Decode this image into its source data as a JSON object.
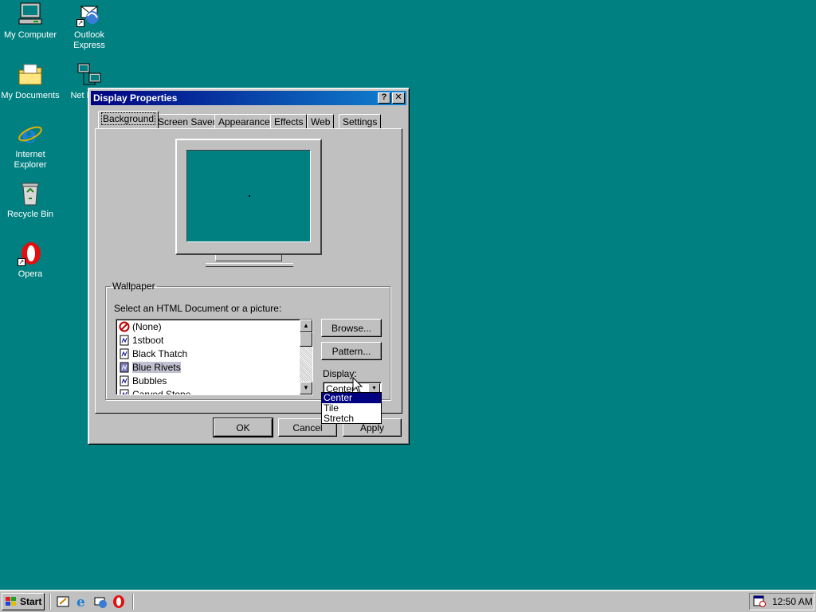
{
  "desktop": {
    "icons": [
      {
        "label": "My Computer",
        "icon": "my-computer-icon"
      },
      {
        "label": "Outlook Express",
        "icon": "outlook-express-icon"
      },
      {
        "label": "My Documents",
        "icon": "my-documents-icon"
      },
      {
        "label": "Net Neighb",
        "icon": "network-neighborhood-icon"
      },
      {
        "label": "Internet Explorer",
        "icon": "internet-explorer-icon"
      },
      {
        "label": "Recycle Bin",
        "icon": "recycle-bin-icon"
      },
      {
        "label": "Opera",
        "icon": "opera-icon"
      }
    ]
  },
  "window": {
    "title": "Display Properties",
    "help_glyph": "?",
    "close_glyph": "✕",
    "tabs": [
      {
        "label": "Background",
        "active": true
      },
      {
        "label": "Screen Saver"
      },
      {
        "label": "Appearance"
      },
      {
        "label": "Effects"
      },
      {
        "label": "Web"
      },
      {
        "label": "Settings"
      }
    ],
    "wallpaper": {
      "group_label": "Wallpaper",
      "select_label": "Select an HTML Document or a picture:",
      "items": [
        {
          "label": "(None)",
          "icon": "none-icon"
        },
        {
          "label": "1stboot",
          "icon": "bitmap-file-icon"
        },
        {
          "label": "Black Thatch",
          "icon": "bitmap-file-icon"
        },
        {
          "label": "Blue Rivets",
          "icon": "bitmap-file-icon",
          "selected": true
        },
        {
          "label": "Bubbles",
          "icon": "bitmap-file-icon"
        },
        {
          "label": "Carved Stone",
          "icon": "bitmap-file-icon"
        }
      ],
      "browse_label": "Browse...",
      "pattern_label": "Pattern...",
      "display_label": "Display:",
      "display_value": "Center",
      "display_options": [
        "Center",
        "Tile",
        "Stretch"
      ]
    },
    "buttons": {
      "ok": "OK",
      "cancel": "Cancel",
      "apply": "Apply"
    }
  },
  "taskbar": {
    "start_label": "Start",
    "quick_launch": [
      "show-desktop-icon",
      "internet-explorer-icon",
      "outlook-express-icon",
      "opera-icon"
    ],
    "clock": "12:50 AM"
  },
  "colors": {
    "desktop": "#008080",
    "title_active": "#000080",
    "face": "#c0c0c0",
    "highlight": "#000080"
  }
}
